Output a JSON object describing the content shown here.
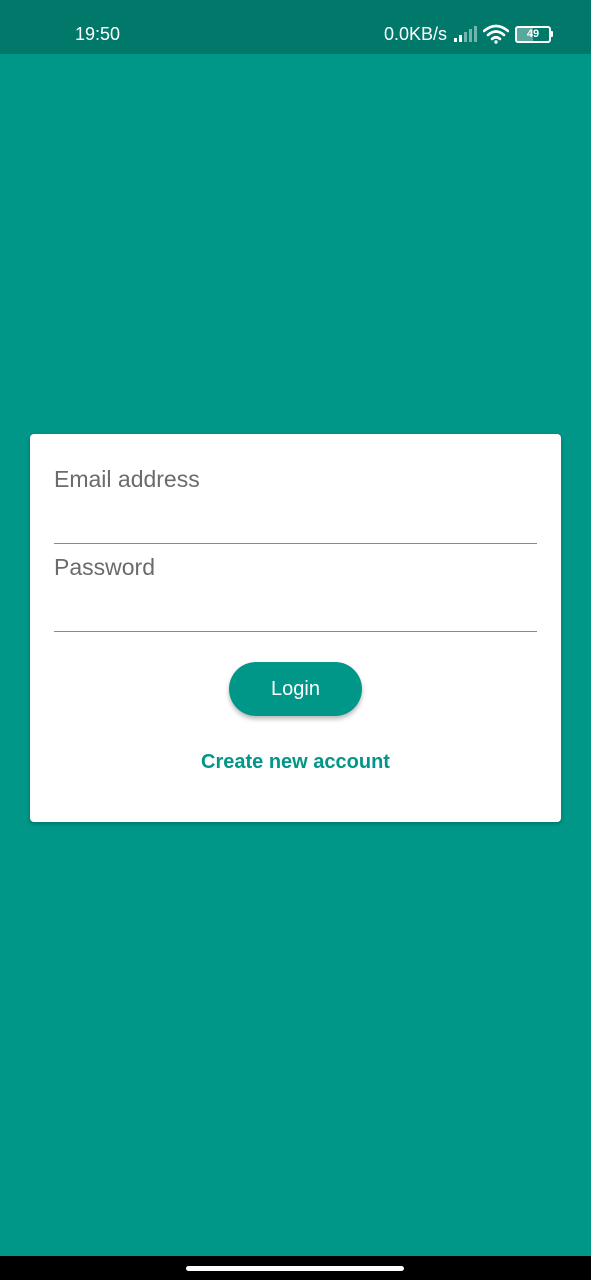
{
  "status_bar": {
    "time": "19:50",
    "network_speed": "0.0KB/s",
    "battery_level": "49",
    "signal_icon": "signal-bars-icon",
    "wifi_icon": "wifi-icon",
    "battery_icon": "battery-icon"
  },
  "login_form": {
    "email_placeholder": "Email address",
    "email_value": "",
    "password_placeholder": "Password",
    "password_value": "",
    "login_label": "Login",
    "create_account_label": "Create new account"
  },
  "colors": {
    "background": "#009688",
    "status_bar": "#00796b",
    "accent": "#009688",
    "card": "#ffffff"
  }
}
